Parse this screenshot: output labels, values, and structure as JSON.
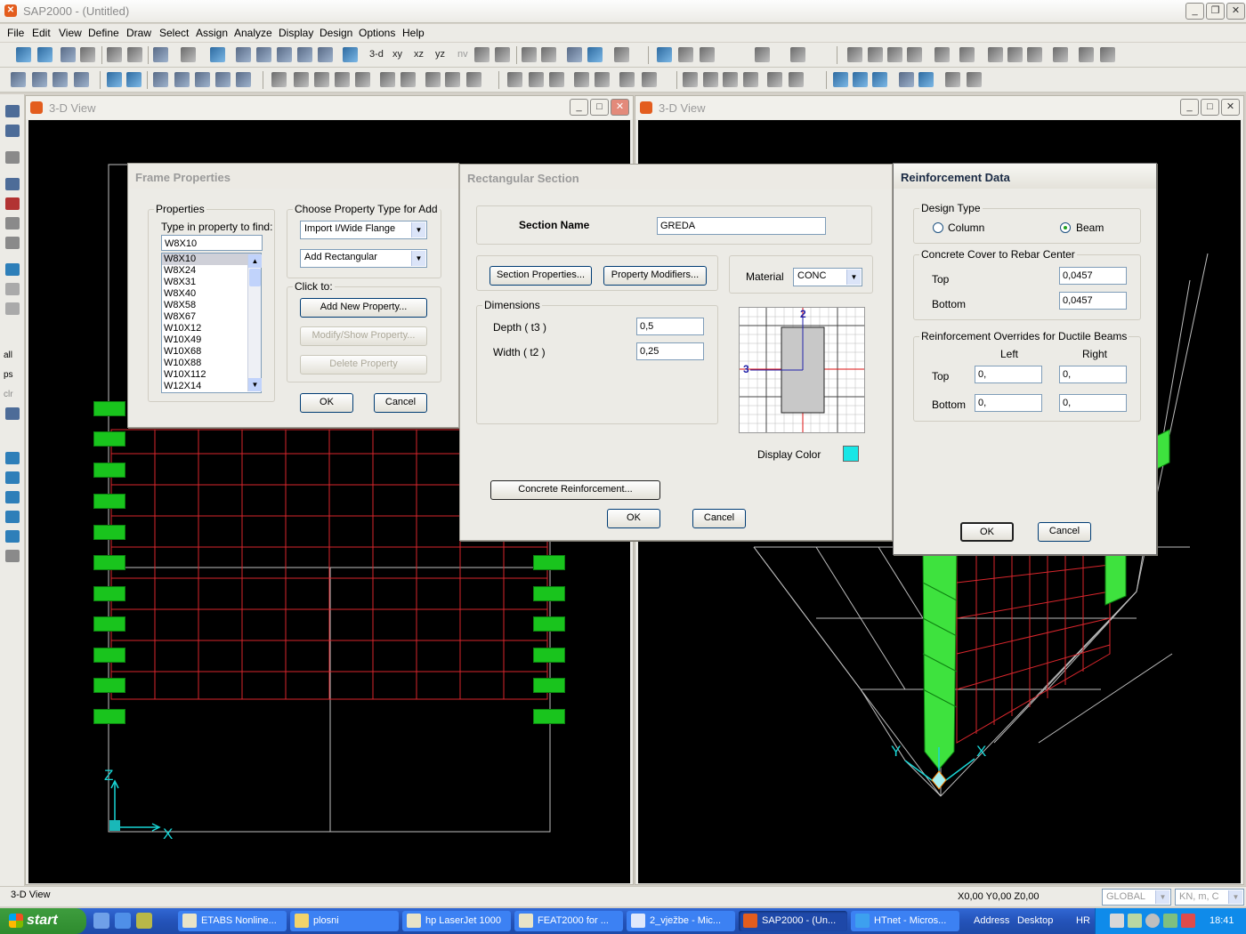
{
  "app": {
    "title": "SAP2000 - (Untitled)"
  },
  "menu": [
    "File",
    "Edit",
    "View",
    "Define",
    "Draw",
    "Select",
    "Assign",
    "Analyze",
    "Display",
    "Design",
    "Options",
    "Help"
  ],
  "toolbar": {
    "view_3d": "3-d",
    "view_xy": "xy",
    "view_xz": "xz",
    "view_yz": "yz",
    "view_nv": "nv"
  },
  "left_toolbar": {
    "all": "all",
    "ps": "ps",
    "clr": "clr"
  },
  "windows": [
    {
      "title": "3-D View"
    },
    {
      "title": "3-D View"
    }
  ],
  "frame_properties": {
    "title": "Frame Properties",
    "properties_group": "Properties",
    "find_label": "Type in property to find:",
    "find_value": "W8X10",
    "items": [
      "W8X10",
      "W8X24",
      "W8X31",
      "W8X40",
      "W8X58",
      "W8X67",
      "W10X12",
      "W10X49",
      "W10X68",
      "W10X88",
      "W10X112",
      "W12X14"
    ],
    "choose_group": "Choose Property Type for Add",
    "type_import": "Import I/Wide Flange",
    "type_add": "Add Rectangular",
    "click_group": "Click to:",
    "add_new": "Add New Property...",
    "modify": "Modify/Show Property...",
    "delete": "Delete Property",
    "ok": "OK",
    "cancel": "Cancel"
  },
  "rect_section": {
    "title": "Rectangular Section",
    "section_name_label": "Section Name",
    "section_name": "GREDA",
    "section_properties": "Section Properties...",
    "property_modifiers": "Property Modifiers...",
    "material_label": "Material",
    "material": "CONC",
    "dimensions_group": "Dimensions",
    "depth_label": "Depth  ( t3 )",
    "depth": "0,5",
    "width_label": "Width  ( t2 )",
    "width": "0,25",
    "axis_2": "2",
    "axis_3": "3",
    "display_color_label": "Display Color",
    "display_color": "#19e6e6",
    "concrete_reinforcement": "Concrete Reinforcement...",
    "ok": "OK",
    "cancel": "Cancel"
  },
  "reinforcement": {
    "title": "Reinforcement Data",
    "design_type_group": "Design Type",
    "column": "Column",
    "beam": "Beam",
    "selected": "Beam",
    "cover_group": "Concrete Cover to Rebar Center",
    "top_label": "Top",
    "top": "0,0457",
    "bottom_label": "Bottom",
    "bottom": "0,0457",
    "overrides_group": "Reinforcement Overrides for Ductile Beams",
    "left_label": "Left",
    "right_label": "Right",
    "top_left": "0,",
    "top_right": "0,",
    "bottom_left": "0,",
    "bottom_right": "0,",
    "ok": "OK",
    "cancel": "Cancel"
  },
  "axes": {
    "z": "Z",
    "x": "X",
    "y": "Y"
  },
  "status": {
    "left": "3-D View",
    "coords": "X0,00  Y0,00  Z0,00",
    "coord_system": "GLOBAL",
    "units": "KN, m, C"
  },
  "taskbar": {
    "start": "start",
    "tasks": [
      "ETABS Nonline...",
      "plosni",
      "hp LaserJet 1000",
      "FEAT2000 for ...",
      "2_vježbe - Mic...",
      "SAP2000 - (Un...",
      "HTnet - Micros..."
    ],
    "address": "Address",
    "desktop": "Desktop",
    "lang": "HR",
    "clock": "18:41"
  }
}
